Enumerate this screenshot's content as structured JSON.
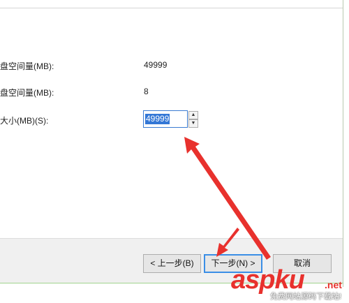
{
  "dialog": {
    "fields": [
      {
        "label": "盘空间量(MB):",
        "value": "49999"
      },
      {
        "label": "盘空间量(MB):",
        "value": "8"
      },
      {
        "label": "大小(MB)(S):"
      }
    ],
    "size_input": {
      "value": "49999",
      "selected_text": "49999"
    },
    "spin_up_glyph": "▲",
    "spin_down_glyph": "▼"
  },
  "footer": {
    "back_label": "< 上一步(B)",
    "next_label": "下一步(N) >",
    "cancel_label": "取消"
  },
  "watermark": {
    "brand": "aspku",
    "tld": ".net",
    "subtitle": "免费网站源码下载站!"
  },
  "colors": {
    "annotation_arrow": "#e8312d",
    "focus_border": "#3a8ee6",
    "selection": "#3377d6"
  }
}
